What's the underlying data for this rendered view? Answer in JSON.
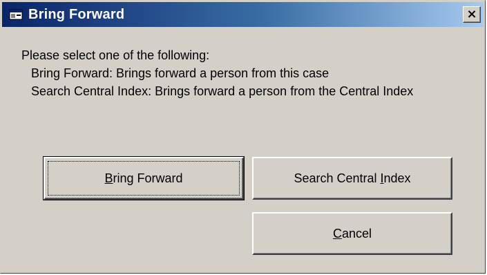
{
  "dialog": {
    "title": "Bring Forward",
    "close_label": "×"
  },
  "message": {
    "line1": "Please select one of the following:",
    "line2": "Bring Forward: Brings forward a person from this case",
    "line3": "Search Central Index: Brings forward a person from the Central Index"
  },
  "buttons": {
    "bring_forward": {
      "prefix": "",
      "mnemonic": "B",
      "suffix": "ring Forward"
    },
    "search_central_index": {
      "prefix": "Search Central ",
      "mnemonic": "I",
      "suffix": "ndex"
    },
    "cancel": {
      "prefix": "",
      "mnemonic": "C",
      "suffix": "ancel"
    }
  },
  "colors": {
    "title_start": "#0a246a",
    "title_end": "#a6caf0",
    "face": "#d4d0c8"
  }
}
